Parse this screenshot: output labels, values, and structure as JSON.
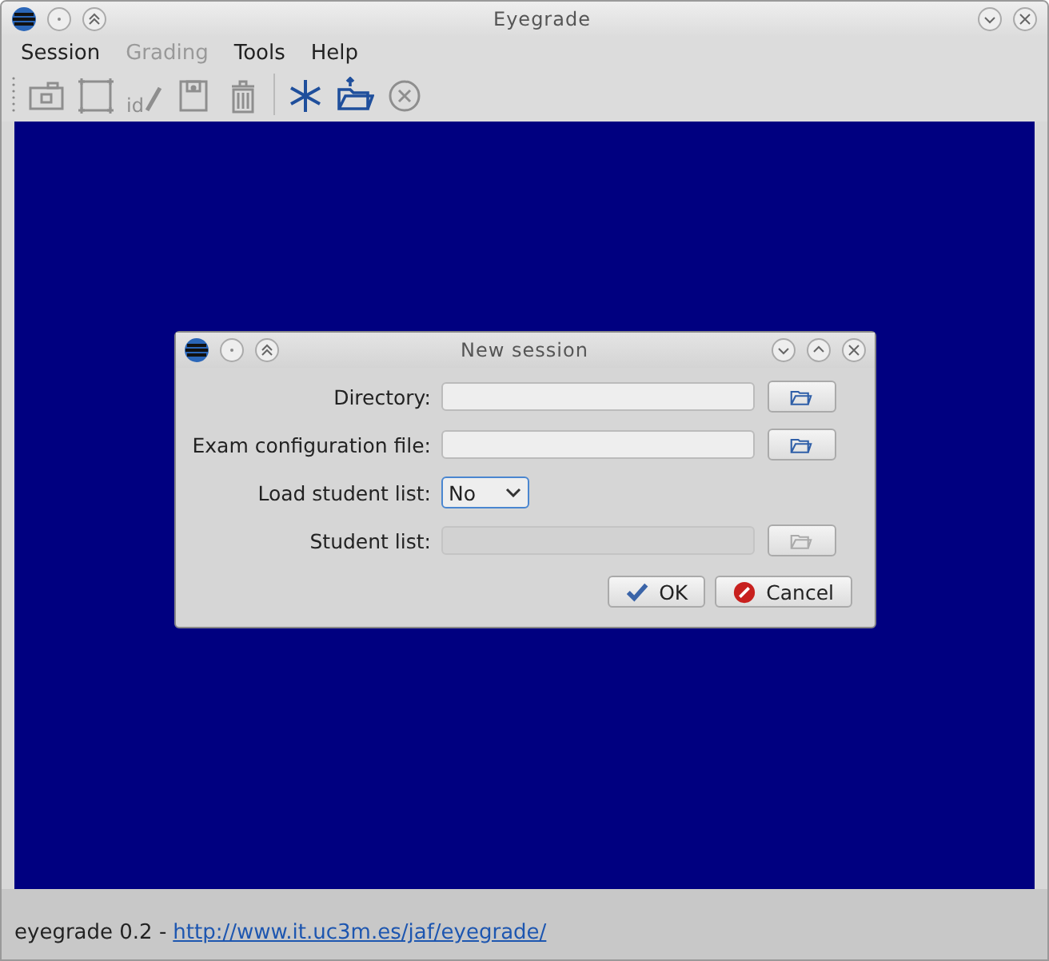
{
  "window": {
    "title": "Eyegrade"
  },
  "menu": [
    {
      "label": "Session",
      "disabled": false
    },
    {
      "label": "Grading",
      "disabled": true
    },
    {
      "label": "Tools",
      "disabled": false
    },
    {
      "label": "Help",
      "disabled": false
    }
  ],
  "toolbar": [
    {
      "kind": "camera",
      "disabled": true
    },
    {
      "kind": "frame",
      "disabled": true
    },
    {
      "kind": "id-pencil",
      "label": "id",
      "disabled": true
    },
    {
      "kind": "save",
      "disabled": true
    },
    {
      "kind": "trash",
      "disabled": true
    },
    {
      "kind": "separator"
    },
    {
      "kind": "asterisk",
      "disabled": false
    },
    {
      "kind": "open",
      "disabled": false
    },
    {
      "kind": "cancel",
      "disabled": true
    }
  ],
  "dialog": {
    "title": "New session",
    "fields": [
      {
        "kind": "path",
        "label": "Directory:",
        "disabled": false
      },
      {
        "kind": "path",
        "label": "Exam configuration file:",
        "disabled": false
      },
      {
        "kind": "select",
        "label": "Load student list:",
        "value": "No"
      },
      {
        "kind": "path",
        "label": "Student list:",
        "disabled": true
      }
    ],
    "buttons": [
      {
        "kind": "ok",
        "label": "OK"
      },
      {
        "kind": "cancel",
        "label": "Cancel"
      }
    ]
  },
  "status_bar": {
    "text": "eyegrade 0.2 -",
    "link": "http://www.it.uc3m.es/jaf/eyegrade/"
  }
}
